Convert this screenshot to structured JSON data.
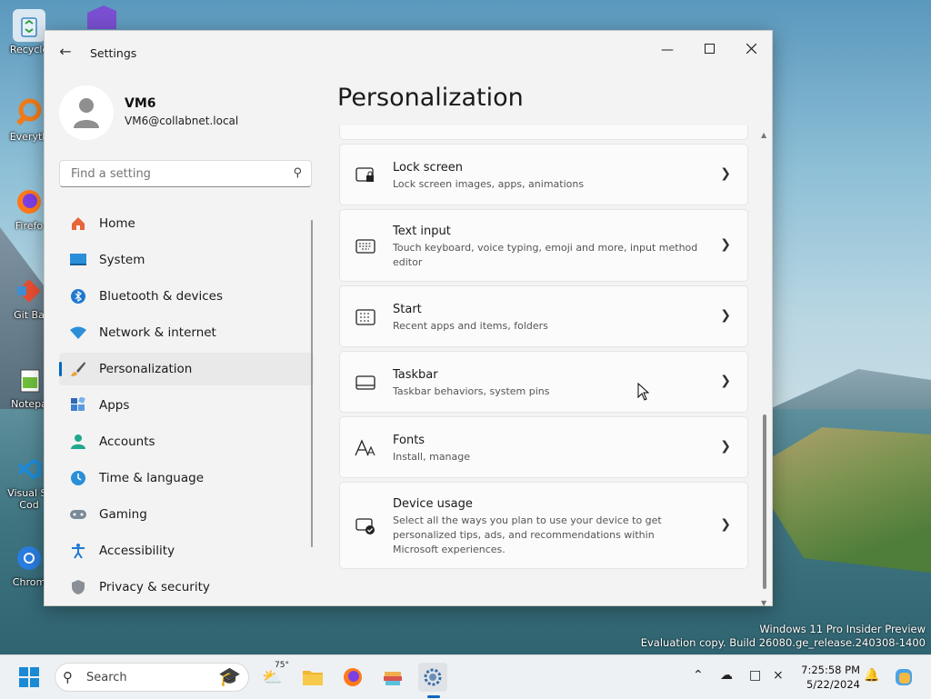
{
  "desktop": {
    "icons": [
      {
        "label": "Recycle",
        "icon": "recycle-bin-icon"
      },
      {
        "label": "Everyth",
        "icon": "everything-search-icon"
      },
      {
        "label": "Firefo",
        "icon": "firefox-icon"
      },
      {
        "label": "Git Ba",
        "icon": "git-bash-icon"
      },
      {
        "label": "Notepa",
        "icon": "notepad-icon"
      },
      {
        "label": "Visual St\nCod",
        "icon": "vscode-icon"
      },
      {
        "label": "Chrom",
        "icon": "chrome-icon"
      }
    ],
    "watermark_line1": "Windows 11 Pro Insider Preview",
    "watermark_line2": "Evaluation copy. Build 26080.ge_release.240308-1400"
  },
  "window": {
    "title": "Settings",
    "back_icon": "back-arrow-icon"
  },
  "profile": {
    "name": "VM6",
    "email": "VM6@collabnet.local"
  },
  "search": {
    "placeholder": "Find a setting"
  },
  "nav": {
    "items": [
      {
        "label": "Home",
        "icon": "home-icon"
      },
      {
        "label": "System",
        "icon": "system-icon"
      },
      {
        "label": "Bluetooth & devices",
        "icon": "bluetooth-icon"
      },
      {
        "label": "Network & internet",
        "icon": "wifi-icon"
      },
      {
        "label": "Personalization",
        "icon": "brush-icon",
        "active": true
      },
      {
        "label": "Apps",
        "icon": "apps-icon"
      },
      {
        "label": "Accounts",
        "icon": "accounts-icon"
      },
      {
        "label": "Time & language",
        "icon": "globe-clock-icon"
      },
      {
        "label": "Gaming",
        "icon": "gamepad-icon"
      },
      {
        "label": "Accessibility",
        "icon": "accessibility-icon"
      },
      {
        "label": "Privacy & security",
        "icon": "shield-icon"
      }
    ]
  },
  "page": {
    "title": "Personalization"
  },
  "cards": [
    {
      "title": "Lock screen",
      "desc": "Lock screen images, apps, animations",
      "icon": "lock-screen-icon"
    },
    {
      "title": "Text input",
      "desc": "Touch keyboard, voice typing, emoji and more, input method editor",
      "icon": "keyboard-icon"
    },
    {
      "title": "Start",
      "desc": "Recent apps and items, folders",
      "icon": "start-icon"
    },
    {
      "title": "Taskbar",
      "desc": "Taskbar behaviors, system pins",
      "icon": "taskbar-icon"
    },
    {
      "title": "Fonts",
      "desc": "Install, manage",
      "icon": "fonts-icon"
    },
    {
      "title": "Device usage",
      "desc": "Select all the ways you plan to use your device to get personalized tips, ads, and recommendations within Microsoft experiences.",
      "icon": "device-usage-icon"
    }
  ],
  "taskbar": {
    "search_label": "Search",
    "weather_temp": "75°",
    "time": "7:25:58 PM",
    "date": "5/22/2024"
  },
  "colors": {
    "accent": "#0067c0"
  }
}
